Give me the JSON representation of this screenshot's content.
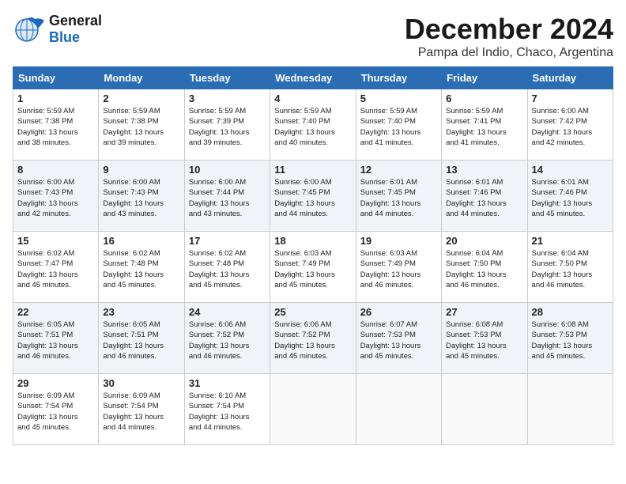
{
  "logo": {
    "general": "General",
    "blue": "Blue"
  },
  "header": {
    "month": "December 2024",
    "location": "Pampa del Indio, Chaco, Argentina"
  },
  "weekdays": [
    "Sunday",
    "Monday",
    "Tuesday",
    "Wednesday",
    "Thursday",
    "Friday",
    "Saturday"
  ],
  "weeks": [
    [
      {
        "day": "1",
        "sunrise": "5:59 AM",
        "sunset": "7:38 PM",
        "daylight": "13 hours and 38 minutes."
      },
      {
        "day": "2",
        "sunrise": "5:59 AM",
        "sunset": "7:38 PM",
        "daylight": "13 hours and 39 minutes."
      },
      {
        "day": "3",
        "sunrise": "5:59 AM",
        "sunset": "7:39 PM",
        "daylight": "13 hours and 39 minutes."
      },
      {
        "day": "4",
        "sunrise": "5:59 AM",
        "sunset": "7:40 PM",
        "daylight": "13 hours and 40 minutes."
      },
      {
        "day": "5",
        "sunrise": "5:59 AM",
        "sunset": "7:40 PM",
        "daylight": "13 hours and 41 minutes."
      },
      {
        "day": "6",
        "sunrise": "5:59 AM",
        "sunset": "7:41 PM",
        "daylight": "13 hours and 41 minutes."
      },
      {
        "day": "7",
        "sunrise": "6:00 AM",
        "sunset": "7:42 PM",
        "daylight": "13 hours and 42 minutes."
      }
    ],
    [
      {
        "day": "8",
        "sunrise": "6:00 AM",
        "sunset": "7:43 PM",
        "daylight": "13 hours and 42 minutes."
      },
      {
        "day": "9",
        "sunrise": "6:00 AM",
        "sunset": "7:43 PM",
        "daylight": "13 hours and 43 minutes."
      },
      {
        "day": "10",
        "sunrise": "6:00 AM",
        "sunset": "7:44 PM",
        "daylight": "13 hours and 43 minutes."
      },
      {
        "day": "11",
        "sunrise": "6:00 AM",
        "sunset": "7:45 PM",
        "daylight": "13 hours and 44 minutes."
      },
      {
        "day": "12",
        "sunrise": "6:01 AM",
        "sunset": "7:45 PM",
        "daylight": "13 hours and 44 minutes."
      },
      {
        "day": "13",
        "sunrise": "6:01 AM",
        "sunset": "7:46 PM",
        "daylight": "13 hours and 44 minutes."
      },
      {
        "day": "14",
        "sunrise": "6:01 AM",
        "sunset": "7:46 PM",
        "daylight": "13 hours and 45 minutes."
      }
    ],
    [
      {
        "day": "15",
        "sunrise": "6:02 AM",
        "sunset": "7:47 PM",
        "daylight": "13 hours and 45 minutes."
      },
      {
        "day": "16",
        "sunrise": "6:02 AM",
        "sunset": "7:48 PM",
        "daylight": "13 hours and 45 minutes."
      },
      {
        "day": "17",
        "sunrise": "6:02 AM",
        "sunset": "7:48 PM",
        "daylight": "13 hours and 45 minutes."
      },
      {
        "day": "18",
        "sunrise": "6:03 AM",
        "sunset": "7:49 PM",
        "daylight": "13 hours and 45 minutes."
      },
      {
        "day": "19",
        "sunrise": "6:03 AM",
        "sunset": "7:49 PM",
        "daylight": "13 hours and 46 minutes."
      },
      {
        "day": "20",
        "sunrise": "6:04 AM",
        "sunset": "7:50 PM",
        "daylight": "13 hours and 46 minutes."
      },
      {
        "day": "21",
        "sunrise": "6:04 AM",
        "sunset": "7:50 PM",
        "daylight": "13 hours and 46 minutes."
      }
    ],
    [
      {
        "day": "22",
        "sunrise": "6:05 AM",
        "sunset": "7:51 PM",
        "daylight": "13 hours and 46 minutes."
      },
      {
        "day": "23",
        "sunrise": "6:05 AM",
        "sunset": "7:51 PM",
        "daylight": "13 hours and 46 minutes."
      },
      {
        "day": "24",
        "sunrise": "6:06 AM",
        "sunset": "7:52 PM",
        "daylight": "13 hours and 46 minutes."
      },
      {
        "day": "25",
        "sunrise": "6:06 AM",
        "sunset": "7:52 PM",
        "daylight": "13 hours and 45 minutes."
      },
      {
        "day": "26",
        "sunrise": "6:07 AM",
        "sunset": "7:53 PM",
        "daylight": "13 hours and 45 minutes."
      },
      {
        "day": "27",
        "sunrise": "6:08 AM",
        "sunset": "7:53 PM",
        "daylight": "13 hours and 45 minutes."
      },
      {
        "day": "28",
        "sunrise": "6:08 AM",
        "sunset": "7:53 PM",
        "daylight": "13 hours and 45 minutes."
      }
    ],
    [
      {
        "day": "29",
        "sunrise": "6:09 AM",
        "sunset": "7:54 PM",
        "daylight": "13 hours and 45 minutes."
      },
      {
        "day": "30",
        "sunrise": "6:09 AM",
        "sunset": "7:54 PM",
        "daylight": "13 hours and 44 minutes."
      },
      {
        "day": "31",
        "sunrise": "6:10 AM",
        "sunset": "7:54 PM",
        "daylight": "13 hours and 44 minutes."
      },
      null,
      null,
      null,
      null
    ]
  ]
}
